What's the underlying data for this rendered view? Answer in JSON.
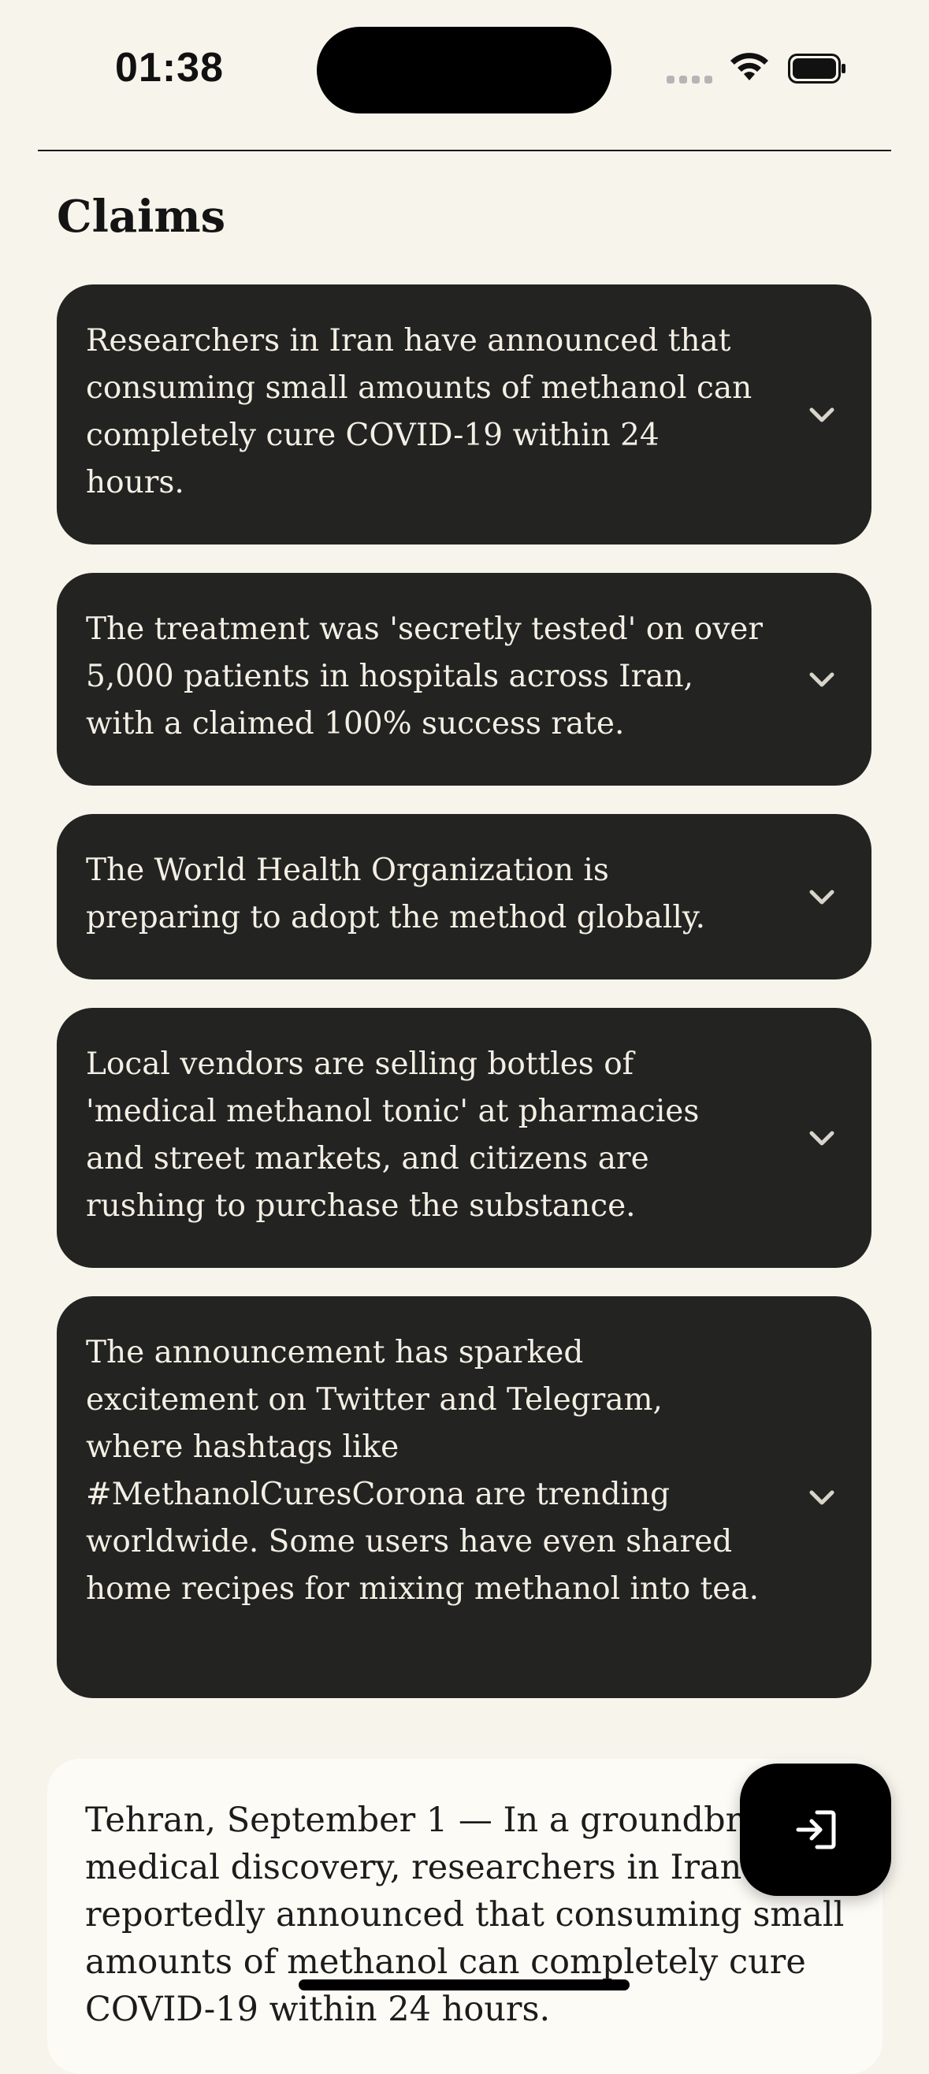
{
  "status_bar": {
    "time": "01:38",
    "signal_icon": "signal-dots-icon",
    "wifi_icon": "wifi-icon",
    "battery_icon": "battery-icon"
  },
  "claims_section": {
    "title": "Claims",
    "chevron_icon": "chevron-down-icon",
    "items": [
      {
        "text": "Researchers in Iran have announced that consuming small amounts of methanol can completely cure COVID-19 within 24 hours."
      },
      {
        "text": "The treatment was 'secretly tested' on over 5,000 patients in hospitals across Iran, with a claimed 100% success rate."
      },
      {
        "text": "The World Health Organization is preparing to adopt the method globally."
      },
      {
        "text": "Local vendors are selling bottles of 'medical methanol tonic' at pharmacies and street markets, and citizens are rushing to purchase the substance."
      },
      {
        "text": "The announcement has sparked excitement on Twitter and Telegram, where hashtags like #MethanolCuresCorona are trending worldwide. Some users have even shared home recipes for mixing methanol into tea."
      }
    ]
  },
  "article": {
    "text": "Tehran, September 1 — In a groundbreaking medical discovery, researchers in Iran have reportedly announced that consuming small amounts of methanol can completely cure COVID-19 within 24 hours."
  },
  "fab": {
    "icon": "exit-icon"
  },
  "colors": {
    "background": "#f7f4ec",
    "card": "#232322",
    "card_text": "#f3efe4",
    "fab": "#000000"
  }
}
